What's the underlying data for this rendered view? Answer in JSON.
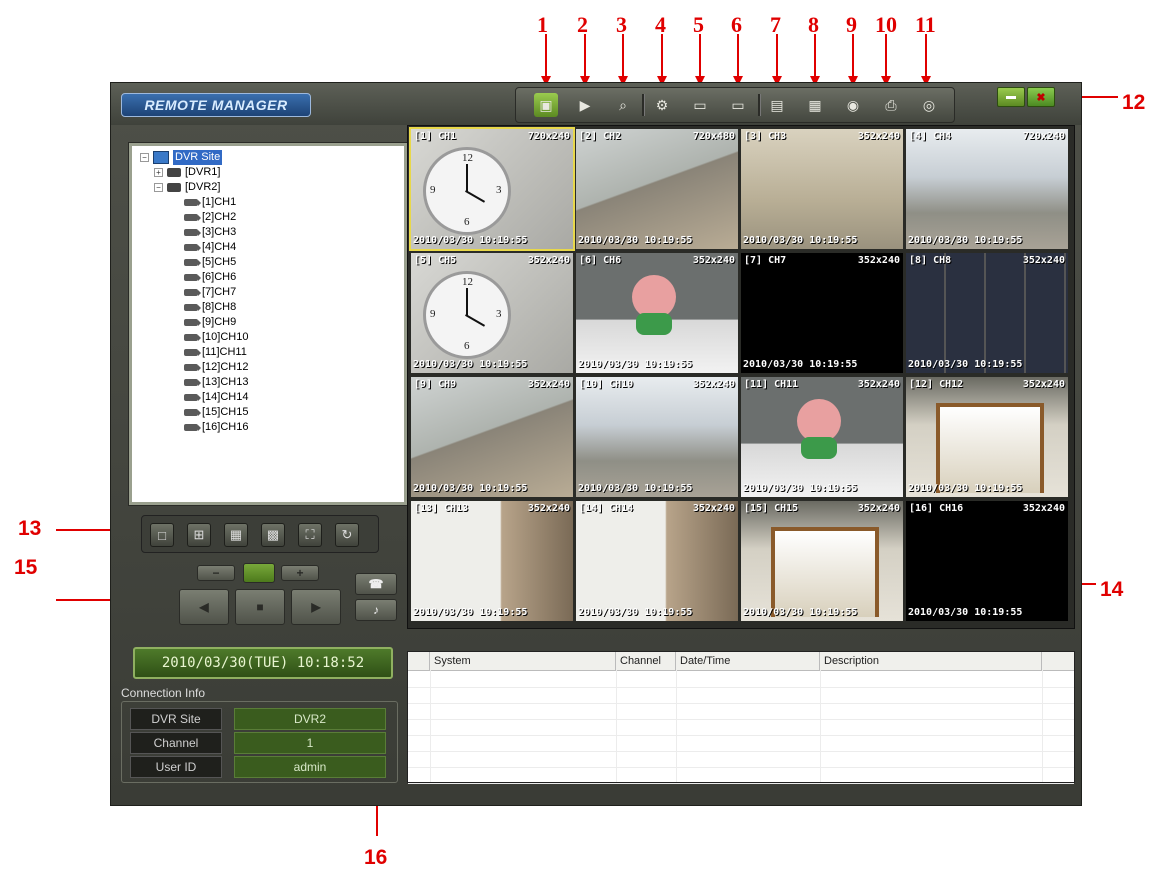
{
  "callouts": {
    "n1": "1",
    "n2": "2",
    "n3": "3",
    "n4": "4",
    "n5": "5",
    "n6": "6",
    "n7": "7",
    "n8": "8",
    "n9": "9",
    "n10": "10",
    "n11": "11",
    "n12": "12",
    "n13": "13",
    "n14": "14",
    "n15": "15",
    "n16": "16"
  },
  "app": {
    "logo": "REMOTE MANAGER"
  },
  "tree": {
    "root": "DVR Site",
    "dvr1": "[DVR1]",
    "dvr2": "[DVR2]",
    "channels": [
      "[1]CH1",
      "[2]CH2",
      "[3]CH3",
      "[4]CH4",
      "[5]CH5",
      "[6]CH6",
      "[7]CH7",
      "[8]CH8",
      "[9]CH9",
      "[10]CH10",
      "[11]CH11",
      "[12]CH12",
      "[13]CH13",
      "[14]CH14",
      "[15]CH15",
      "[16]CH16"
    ]
  },
  "status": {
    "datetime": "2010/03/30(TUE) 10:18:52"
  },
  "connection": {
    "title": "Connection Info",
    "dvr_site_label": "DVR Site",
    "dvr_site_value": "DVR2",
    "channel_label": "Channel",
    "channel_value": "1",
    "user_label": "User ID",
    "user_value": "admin"
  },
  "cells": [
    {
      "label": "[1] CH1",
      "res": "720x240",
      "ts": "2010/03/30 10:19:55"
    },
    {
      "label": "[2] CH2",
      "res": "720x480",
      "ts": "2010/03/30 10:19:55"
    },
    {
      "label": "[3] CH3",
      "res": "352x240",
      "ts": "2010/03/30 10:19:55"
    },
    {
      "label": "[4] CH4",
      "res": "720x240",
      "ts": "2010/03/30 10:19:55"
    },
    {
      "label": "[5] CH5",
      "res": "352x240",
      "ts": "2010/03/30 10:19:55"
    },
    {
      "label": "[6] CH6",
      "res": "352x240",
      "ts": "2010/03/30 10:19:55"
    },
    {
      "label": "[7] CH7",
      "res": "352x240",
      "ts": "2010/03/30 10:19:55"
    },
    {
      "label": "[8] CH8",
      "res": "352x240",
      "ts": "2010/03/30 10:19:55"
    },
    {
      "label": "[9] CH9",
      "res": "352x240",
      "ts": "2010/03/30 10:19:55"
    },
    {
      "label": "[10] CH10",
      "res": "352x240",
      "ts": "2010/03/30 10:19:55"
    },
    {
      "label": "[11] CH11",
      "res": "352x240",
      "ts": "2010/03/30 10:19:55"
    },
    {
      "label": "[12] CH12",
      "res": "352x240",
      "ts": "2010/03/30 10:19:55"
    },
    {
      "label": "[13] CH13",
      "res": "352x240",
      "ts": "2010/03/30 10:19:55"
    },
    {
      "label": "[14] CH14",
      "res": "352x240",
      "ts": "2010/03/30 10:19:55"
    },
    {
      "label": "[15] CH15",
      "res": "352x240",
      "ts": "2010/03/30 10:19:55"
    },
    {
      "label": "[16] CH16",
      "res": "352x240",
      "ts": "2010/03/30 10:19:55"
    }
  ],
  "log": {
    "columns": [
      "System",
      "Channel",
      "Date/Time",
      "Description"
    ]
  },
  "icons": {
    "toolbar": [
      "live-monitor-icon",
      "playback-icon",
      "search-icon",
      "setup-icon",
      "dvr-add-icon",
      "dvr-edit-icon",
      "info-icon",
      "save-icon",
      "record-icon",
      "print-icon",
      "zoom-icon"
    ],
    "window": [
      "minimize-icon",
      "close-icon"
    ],
    "layout": [
      "layout-1-icon",
      "layout-4-icon",
      "layout-9-icon",
      "layout-16-icon",
      "fullscreen-icon",
      "sequence-icon"
    ]
  }
}
